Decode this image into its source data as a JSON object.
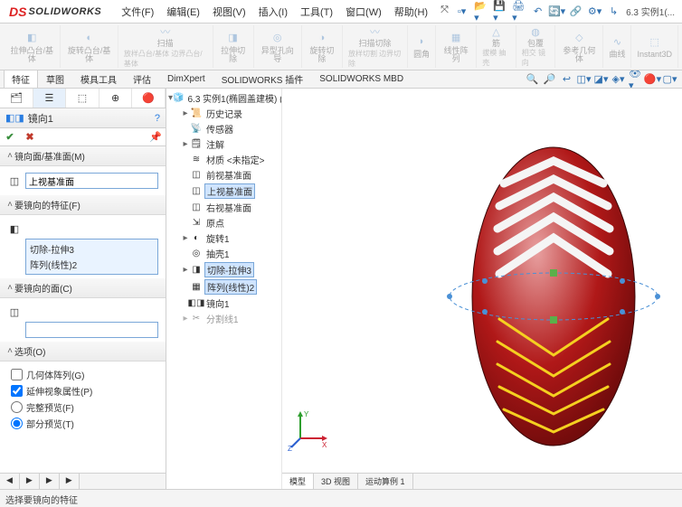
{
  "logo": "SOLIDWORKS",
  "menus": [
    "文件(F)",
    "编辑(E)",
    "视图(V)",
    "插入(I)",
    "工具(T)",
    "窗口(W)",
    "帮助(H)"
  ],
  "docTitle": "6.3 实例1(...",
  "ribbon": [
    {
      "label": "拉伸凸台/基体",
      "sub": ""
    },
    {
      "label": "旋转凸台/基体",
      "sub": ""
    },
    {
      "label": "扫描",
      "sub": "放样凸台/基体\n边界凸台/基体"
    },
    {
      "label": "拉伸切除",
      "sub": ""
    },
    {
      "label": "异型孔向导",
      "sub": ""
    },
    {
      "label": "旋转切除",
      "sub": ""
    },
    {
      "label": "扫描切除",
      "sub": "放样切割\n边界切除"
    },
    {
      "label": "圆角",
      "sub": ""
    },
    {
      "label": "线性阵列",
      "sub": ""
    },
    {
      "label": "筋",
      "sub": "拔模\n抽壳"
    },
    {
      "label": "包覆",
      "sub": "相交\n镜向"
    },
    {
      "label": "参考几何体",
      "sub": ""
    },
    {
      "label": "曲线",
      "sub": ""
    },
    {
      "label": "Instant3D",
      "sub": ""
    }
  ],
  "tabs": [
    "特征",
    "草图",
    "模具工具",
    "评估",
    "DimXpert",
    "SOLIDWORKS 插件",
    "SOLIDWORKS MBD"
  ],
  "activeTabIndex": 0,
  "prop": {
    "title": "镜向1",
    "sections": {
      "mirrorPlane": {
        "head": "镜向面/基准面(M)",
        "value": "上视基准面"
      },
      "features": {
        "head": "要镜向的特征(F)",
        "items": [
          "切除-拉伸3",
          "阵列(线性)2"
        ]
      },
      "faces": {
        "head": "要镜向的面(C)"
      },
      "options": {
        "head": "选项(O)",
        "chk1": {
          "label": "几何体阵列(G)",
          "v": false
        },
        "chk2": {
          "label": "延伸视象属性(P)",
          "v": true
        },
        "r1": {
          "label": "完整预览(F)",
          "v": false
        },
        "r2": {
          "label": "部分预览(T)",
          "v": true
        }
      }
    }
  },
  "tree": [
    {
      "ind": 0,
      "caret": "▾",
      "icon": "part",
      "label": "6.3 实例1(椭圆盖建模) (..."
    },
    {
      "ind": 1,
      "caret": "▸",
      "icon": "hist",
      "label": "历史记录"
    },
    {
      "ind": 1,
      "caret": "",
      "icon": "sensor",
      "label": "传感器"
    },
    {
      "ind": 1,
      "caret": "▸",
      "icon": "note",
      "label": "注解"
    },
    {
      "ind": 1,
      "caret": "",
      "icon": "mat",
      "label": "材质 <未指定>"
    },
    {
      "ind": 1,
      "caret": "",
      "icon": "plane",
      "label": "前视基准面"
    },
    {
      "ind": 1,
      "caret": "",
      "icon": "plane",
      "label": "上视基准面",
      "hl": true
    },
    {
      "ind": 1,
      "caret": "",
      "icon": "plane",
      "label": "右视基准面"
    },
    {
      "ind": 1,
      "caret": "",
      "icon": "origin",
      "label": "原点"
    },
    {
      "ind": 1,
      "caret": "▸",
      "icon": "rev",
      "label": "旋转1"
    },
    {
      "ind": 1,
      "caret": "",
      "icon": "shell",
      "label": "抽壳1"
    },
    {
      "ind": 1,
      "caret": "▸",
      "icon": "cut",
      "label": "切除-拉伸3",
      "hl": true
    },
    {
      "ind": 1,
      "caret": "",
      "icon": "pattern",
      "label": "阵列(线性)2",
      "hl": true
    },
    {
      "ind": 1,
      "caret": "",
      "icon": "mirror",
      "label": "镜向1"
    },
    {
      "ind": 1,
      "caret": "▸",
      "icon": "split",
      "label": "分割线1",
      "dim": true
    }
  ],
  "panelBottomTabs": [
    "",
    "",
    "",
    ""
  ],
  "vpBottomTabs": [
    "模型",
    "3D 视图",
    "运动算例 1"
  ],
  "status": "选择要镜向的特征"
}
